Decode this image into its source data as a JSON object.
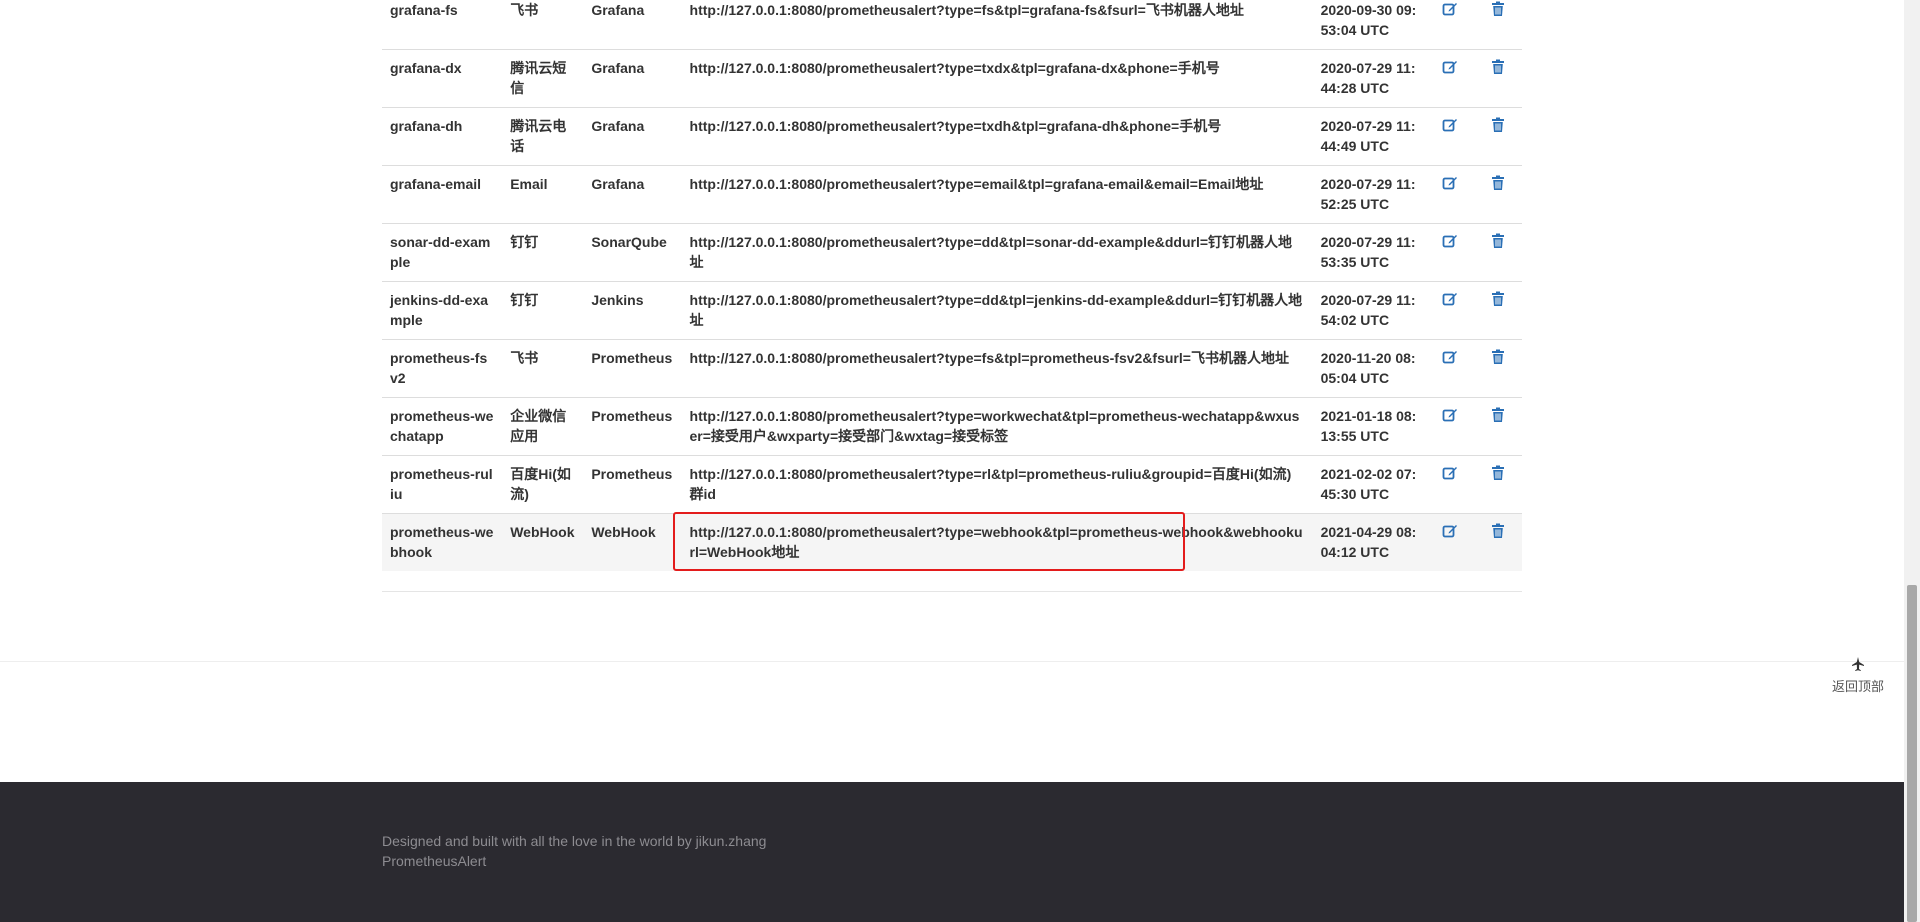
{
  "table": {
    "rows": [
      {
        "name": "grafana-fs",
        "type": "飞书",
        "source": "Grafana",
        "url": "http://127.0.0.1:8080/prometheusalert?type=fs&tpl=grafana-fs&fsurl=飞书机器人地址",
        "time": "2020-09-30 09:53:04 UTC"
      },
      {
        "name": "grafana-dx",
        "type": "腾讯云短信",
        "source": "Grafana",
        "url": "http://127.0.0.1:8080/prometheusalert?type=txdx&tpl=grafana-dx&phone=手机号",
        "time": "2020-07-29 11:44:28 UTC"
      },
      {
        "name": "grafana-dh",
        "type": "腾讯云电话",
        "source": "Grafana",
        "url": "http://127.0.0.1:8080/prometheusalert?type=txdh&tpl=grafana-dh&phone=手机号",
        "time": "2020-07-29 11:44:49 UTC"
      },
      {
        "name": "grafana-email",
        "type": "Email",
        "source": "Grafana",
        "url": "http://127.0.0.1:8080/prometheusalert?type=email&tpl=grafana-email&email=Email地址",
        "time": "2020-07-29 11:52:25 UTC"
      },
      {
        "name": "sonar-dd-example",
        "type": "钉钉",
        "source": "SonarQube",
        "url": "http://127.0.0.1:8080/prometheusalert?type=dd&tpl=sonar-dd-example&ddurl=钉钉机器人地址",
        "time": "2020-07-29 11:53:35 UTC"
      },
      {
        "name": "jenkins-dd-example",
        "type": "钉钉",
        "source": "Jenkins",
        "url": "http://127.0.0.1:8080/prometheusalert?type=dd&tpl=jenkins-dd-example&ddurl=钉钉机器人地址",
        "time": "2020-07-29 11:54:02 UTC"
      },
      {
        "name": "prometheus-fsv2",
        "type": "飞书",
        "source": "Prometheus",
        "url": "http://127.0.0.1:8080/prometheusalert?type=fs&tpl=prometheus-fsv2&fsurl=飞书机器人地址",
        "time": "2020-11-20 08:05:04 UTC"
      },
      {
        "name": "prometheus-wechatapp",
        "type": "企业微信应用",
        "source": "Prometheus",
        "url": "http://127.0.0.1:8080/prometheusalert?type=workwechat&tpl=prometheus-wechatapp&wxuser=接受用户&wxparty=接受部门&wxtag=接受标签",
        "time": "2021-01-18 08:13:55 UTC"
      },
      {
        "name": "prometheus-ruliu",
        "type": "百度Hi(如流)",
        "source": "Prometheus",
        "url": "http://127.0.0.1:8080/prometheusalert?type=rl&tpl=prometheus-ruliu&groupid=百度Hi(如流)群id",
        "time": "2021-02-02 07:45:30 UTC"
      },
      {
        "name": "prometheus-webhook",
        "type": "WebHook",
        "source": "WebHook",
        "url": "http://127.0.0.1:8080/prometheusalert?type=webhook&tpl=prometheus-webhook&webhookurl=WebHook地址",
        "time": "2021-04-29 08:04:12 UTC"
      }
    ],
    "highlighted_row": 9
  },
  "back_to_top": {
    "label": "返回顶部",
    "icon": "airplane-icon"
  },
  "footer": {
    "credit": "Designed and built with all the love in the world by jikun.zhang",
    "project": "PrometheusAlert"
  },
  "colors": {
    "highlight": "#e31c1c",
    "icon": "#2a6fb5",
    "footer_bg": "#2b2a30"
  }
}
